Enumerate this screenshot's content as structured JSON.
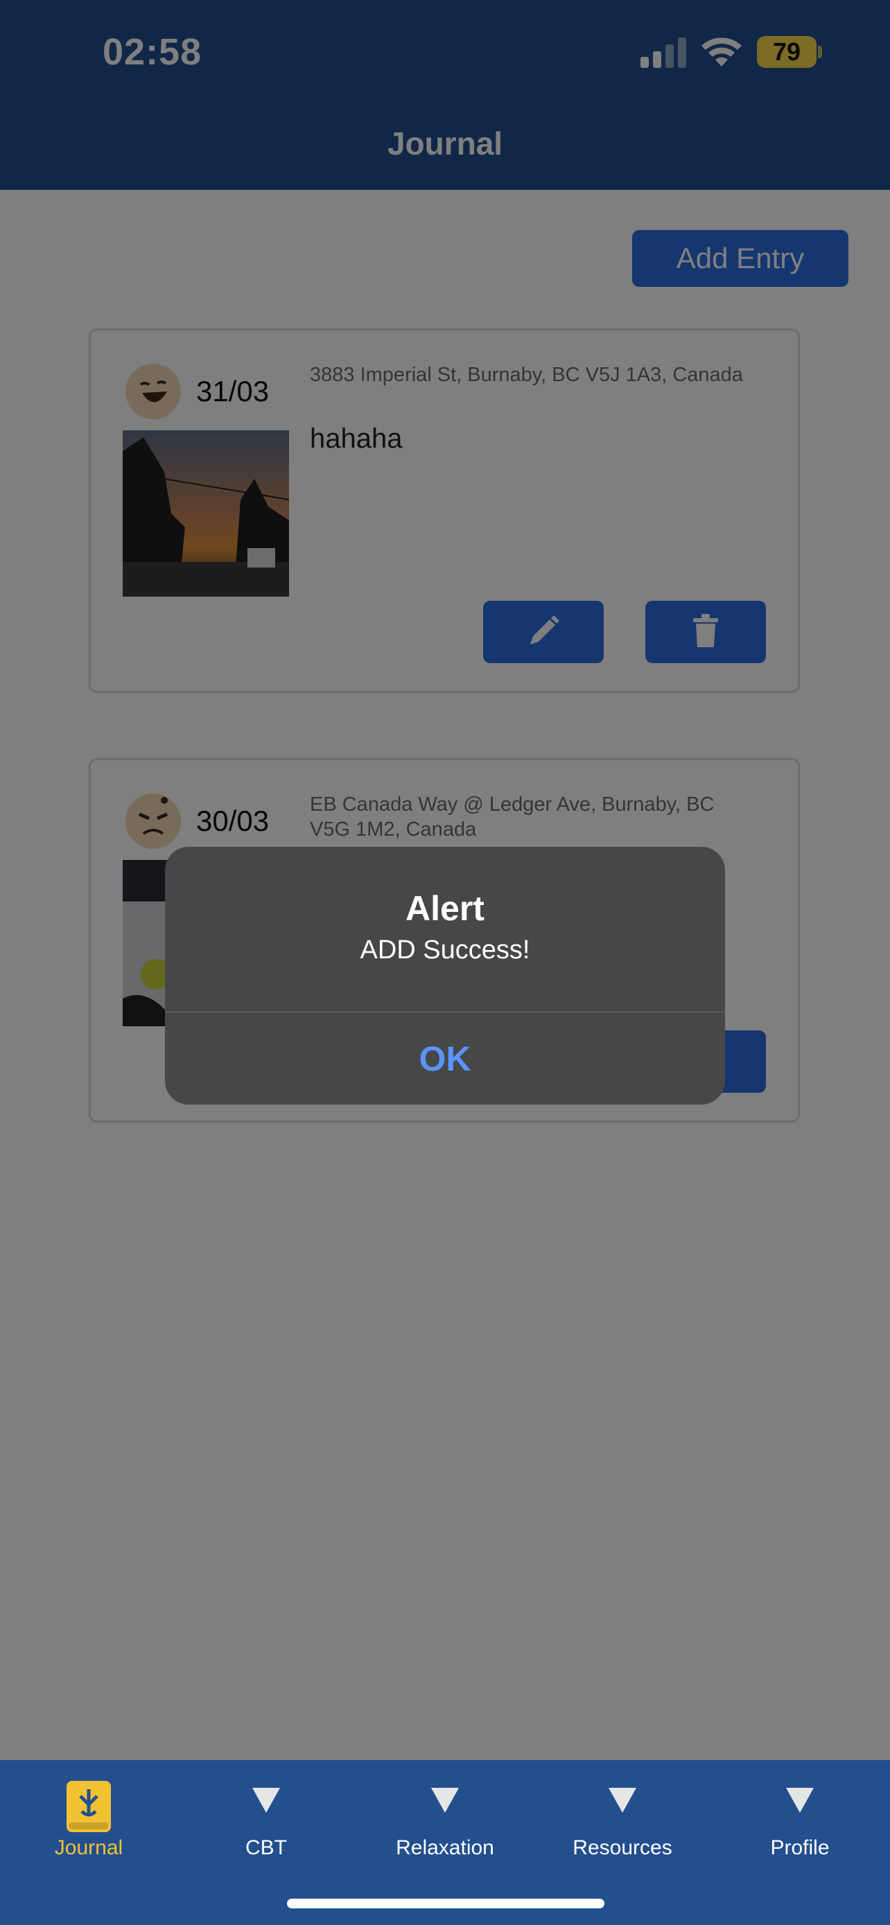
{
  "status": {
    "time": "02:58",
    "battery": "79"
  },
  "header": {
    "title": "Journal"
  },
  "toolbar": {
    "add_entry_label": "Add Entry"
  },
  "entries": [
    {
      "date": "31/03",
      "location": "3883 Imperial St, Burnaby, BC V5J 1A3, Canada",
      "text": "hahaha",
      "mood": "laughing-face-icon"
    },
    {
      "date": "30/03",
      "location": "EB Canada Way @ Ledger Ave, Burnaby, BC V5G 1M2, Canada",
      "text": "",
      "mood": "angry-face-icon"
    }
  ],
  "alert": {
    "title": "Alert",
    "message": "ADD Success!",
    "ok_label": "OK"
  },
  "tabs": [
    {
      "label": "Journal",
      "icon": "journal-book-icon",
      "active": true
    },
    {
      "label": "CBT",
      "icon": "triangle-icon",
      "active": false
    },
    {
      "label": "Relaxation",
      "icon": "triangle-icon",
      "active": false
    },
    {
      "label": "Resources",
      "icon": "triangle-icon",
      "active": false
    },
    {
      "label": "Profile",
      "icon": "triangle-icon",
      "active": false
    }
  ],
  "colors": {
    "primary": "#234f8f",
    "button": "#2d6de0",
    "active_tab": "#f1c232",
    "alert_ok": "#5a94ff"
  }
}
